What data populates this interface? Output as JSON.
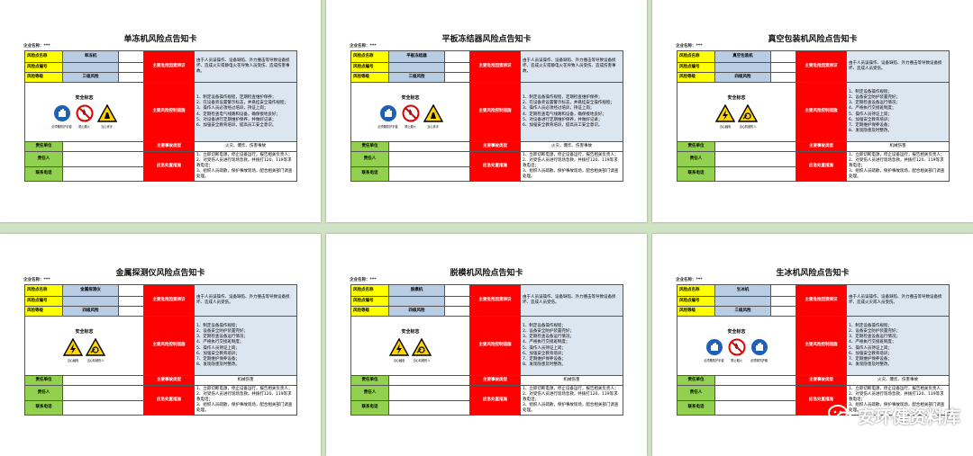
{
  "labels": {
    "company": "企业名称：***",
    "risk_name": "风险点名称",
    "risk_code": "风险点编号",
    "risk_level": "风险等级",
    "risk_factors": "主要危险因素辨识",
    "safety_signs": "安全标志",
    "control_measures": "主要风险控制措施",
    "resp_unit": "责任单位",
    "emergency": "应急处置措施",
    "resp_person": "责任人",
    "contact": "联系电话",
    "main_accident_types": "主要事故类型"
  },
  "cards": [
    {
      "title": "单冻机风险点告知卡",
      "name": "单冻机",
      "level": "三级风险",
      "factors": "由于人员误操作、设备缺陷、外力撞击等导致设备损坏、造成火灾或静电火花导致人员受伤、造成伤害事故。",
      "measures": [
        "1、制定设备操作规程，定期检查维护保养；",
        "2、在设备旁设置警示标志，并悬挂安全操作规程；",
        "3、操作人员必须经过培训，持证上岗；",
        "4、定期检查电气线路和设备，确保接地良好；",
        "5、对设备进行定期维护保养，并做好记录；",
        "6、加强安全教育培训，提高员工安全意识。"
      ],
      "accident": "火灾、爆炸、伤害事故",
      "emergency": [
        "1、立即切断电源，停止设备运行，报告相关负责人；",
        "2、对受伤人员进行现场急救，并拨打120、119等求救电话；",
        "3、组织人员疏散，保护事故现场，配合相关部门调查处理。"
      ],
      "signs": [
        {
          "type": "mandatory",
          "label": "必须戴防护手套"
        },
        {
          "type": "prohibition",
          "label": "禁止烟火"
        },
        {
          "type": "warning-hand",
          "label": "当心夹手"
        }
      ]
    },
    {
      "title": "平板冻结器风险点告知卡",
      "name": "平板冻结器",
      "level": "三级风险",
      "factors": "由于人员误操作、设备缺陷、外力撞击等导致设备损坏、造成火灾或静电火花导致人员受伤、造成伤害事故。",
      "measures": [
        "1、制定设备操作规程，定期检查维护保养；",
        "2、在设备旁设置警示标志，并悬挂安全操作规程；",
        "3、操作人员必须经过培训，持证上岗；",
        "4、定期检查电气线路和设备，确保接地良好；",
        "5、对设备进行定期维护保养，并做好记录；",
        "6、加强安全教育培训，提高员工安全意识。"
      ],
      "accident": "火灾、爆炸、伤害事故",
      "emergency": [
        "1、立即切断电源，停止设备运行，报告相关负责人；",
        "2、对受伤人员进行现场急救，并拨打120、119等求救电话；",
        "3、组织人员疏散，保护事故现场，配合相关部门调查处理。"
      ],
      "signs": [
        {
          "type": "mandatory",
          "label": "必须戴防护手套"
        },
        {
          "type": "prohibition",
          "label": "禁止烟火"
        },
        {
          "type": "warning-hand",
          "label": "当心夹手"
        }
      ]
    },
    {
      "title": "真空包装机风险点告知卡",
      "name": "真空包装机",
      "level": "四级风险",
      "factors": "由于人员误操作、设备缺陷、外力撞击等导致设备损坏、造成人员受伤。",
      "measures": [
        "1、制定设备操作规程；",
        "2、设备安全防护装置完好；",
        "3、定期检查设备运行情况；",
        "4、严格执行交接班制度；",
        "5、操作人员持证上岗；",
        "6、加强安全教育培训；",
        "7、定期维护保养设备；",
        "8、发现隐患及时整改。"
      ],
      "accident": "机械伤害",
      "emergency": [
        "1、立即切断电源，停止设备运行，报告相关负责人；",
        "2、对受伤人员进行现场急救，并拨打120、119等求救电话；",
        "3、组织人员疏散，保护事故现场，配合相关部门调查处理。"
      ],
      "signs": [
        {
          "type": "warning-electric",
          "label": "当心触电"
        },
        {
          "type": "warning-mech",
          "label": "当心机械伤人"
        }
      ]
    },
    {
      "title": "金属探测仪风险点告知卡",
      "name": "金属探测仪",
      "level": "四级风险",
      "factors": "由于人员误操作、设备缺陷、外力撞击等导致设备损坏、造成人员受伤。",
      "measures": [
        "1、制定设备操作规程；",
        "2、设备安全防护装置完好；",
        "3、定期检查设备运行情况；",
        "4、严格执行交接班制度；",
        "5、操作人员持证上岗；",
        "6、加强安全教育培训；",
        "7、定期维护保养设备；",
        "8、发现隐患及时整改。"
      ],
      "accident": "机械伤害",
      "emergency": [
        "1、立即切断电源，停止设备运行，报告相关负责人；",
        "2、对受伤人员进行现场急救，并拨打120、119等求救电话；",
        "3、组织人员疏散，保护事故现场，配合相关部门调查处理。"
      ],
      "signs": [
        {
          "type": "warning-electric",
          "label": "当心触电"
        },
        {
          "type": "warning-mech",
          "label": "当心机械伤人"
        }
      ]
    },
    {
      "title": "脱模机风险点告知卡",
      "name": "脱模机",
      "level": "四级风险",
      "factors": "由于人员误操作、设备缺陷、外力撞击等导致设备损坏、造成人员受伤。",
      "measures": [
        "1、制定设备操作规程；",
        "2、设备安全防护装置完好；",
        "3、定期检查设备运行情况；",
        "4、严格执行交接班制度；",
        "5、操作人员持证上岗；",
        "6、加强安全教育培训；",
        "7、定期维护保养设备；",
        "8、发现隐患及时整改。"
      ],
      "accident": "机械伤害",
      "emergency": [
        "1、立即切断电源，停止设备运行，报告相关负责人；",
        "2、对受伤人员进行现场急救，并拨打120、119等求救电话；",
        "3、组织人员疏散，保护事故现场，配合相关部门调查处理。"
      ],
      "signs": [
        {
          "type": "warning-electric",
          "label": "当心触电"
        },
        {
          "type": "warning-mech",
          "label": "当心机械伤人"
        }
      ]
    },
    {
      "title": "生冰机风险点告知卡",
      "name": "生冰机",
      "level": "三级风险",
      "factors": "由于人员误操作、设备缺陷、外力撞击等导致设备损坏、造成火灾或人员受伤。",
      "measures": [
        "1、制定设备操作规程；",
        "2、设备安全防护装置完好；",
        "3、定期检查设备运行情况；",
        "4、严格执行交接班制度；",
        "5、操作人员持证上岗；",
        "6、加强安全教育培训；",
        "7、定期维护保养设备；",
        "8、发现隐患及时整改。"
      ],
      "accident": "火灾、爆炸、伤害事故",
      "emergency": [
        "1、立即切断电源，停止设备运行，报告相关负责人；",
        "2、对受伤人员进行现场急救，并拨打120、119等求救电话；",
        "3、组织人员疏散，保护事故现场，配合相关部门调查处理。"
      ],
      "signs": [
        {
          "type": "mandatory",
          "label": "必须戴防护手套"
        },
        {
          "type": "prohibition",
          "label": "禁止烟火"
        },
        {
          "type": "mandatory-blue",
          "label": "必须穿防护服"
        }
      ]
    }
  ],
  "watermark": "安环健资料库",
  "colors": {
    "yellow": "#ffff00",
    "red": "#ff0000",
    "blue": "#b8cce4",
    "lavender": "#dce6f1",
    "green": "#92d050",
    "background": "#cfe2c4"
  }
}
